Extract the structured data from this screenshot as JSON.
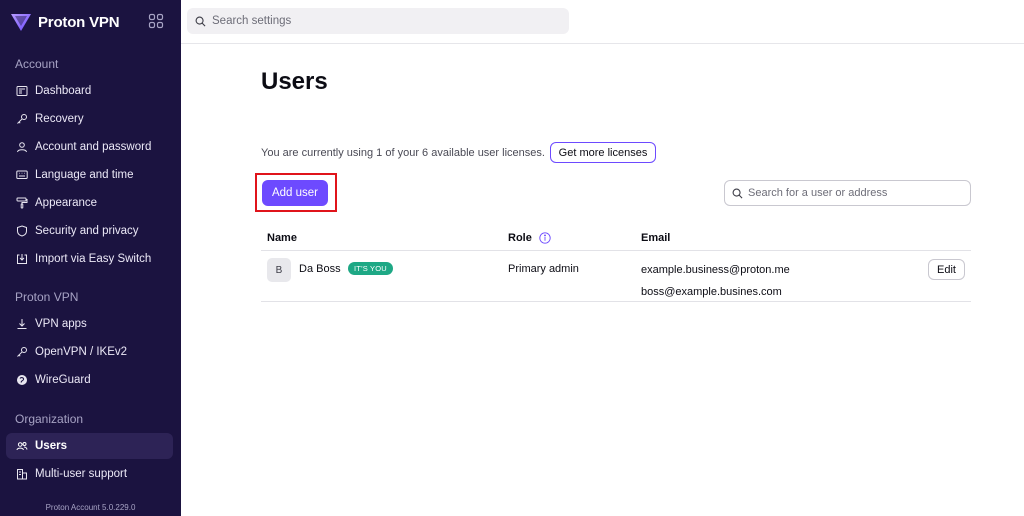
{
  "app": {
    "brand_name": "Proton VPN",
    "version": "Proton Account 5.0.229.0"
  },
  "topbar": {
    "search_placeholder": "Search settings"
  },
  "sidebar": {
    "sections": [
      {
        "title": "Account",
        "items": [
          {
            "label": "Dashboard",
            "icon": "dashboard-icon"
          },
          {
            "label": "Recovery",
            "icon": "key-icon"
          },
          {
            "label": "Account and password",
            "icon": "user-icon"
          },
          {
            "label": "Language and time",
            "icon": "keyboard-icon"
          },
          {
            "label": "Appearance",
            "icon": "paint-roller-icon"
          },
          {
            "label": "Security and privacy",
            "icon": "shield-icon"
          },
          {
            "label": "Import via Easy Switch",
            "icon": "import-icon"
          }
        ]
      },
      {
        "title": "Proton VPN",
        "items": [
          {
            "label": "VPN apps",
            "icon": "download-icon"
          },
          {
            "label": "OpenVPN / IKEv2",
            "icon": "key-icon"
          },
          {
            "label": "WireGuard",
            "icon": "wireguard-icon"
          }
        ]
      },
      {
        "title": "Organization",
        "items": [
          {
            "label": "Users",
            "icon": "users-icon",
            "active": true
          },
          {
            "label": "Multi-user support",
            "icon": "buildings-icon"
          }
        ]
      }
    ]
  },
  "main": {
    "title": "Users",
    "license_prefix": "You are currently using ",
    "license_used": "1",
    "license_middle": " of your 6 available user licenses.",
    "get_more_label": "Get more licenses",
    "add_user_label": "Add user",
    "user_search_placeholder": "Search for a user or address",
    "table": {
      "headers": {
        "name": "Name",
        "role": "Role",
        "email": "Email"
      },
      "rows": [
        {
          "initial": "B",
          "name": "Da Boss",
          "badge": "IT'S YOU",
          "role": "Primary admin",
          "emails": [
            "example.business@proton.me",
            "boss@example.busines.com"
          ],
          "action": "Edit"
        }
      ]
    }
  },
  "colors": {
    "sidebar_bg": "#1b1340",
    "accent": "#6d4aff",
    "badge": "#1ea885",
    "highlight": "#e0141b"
  }
}
